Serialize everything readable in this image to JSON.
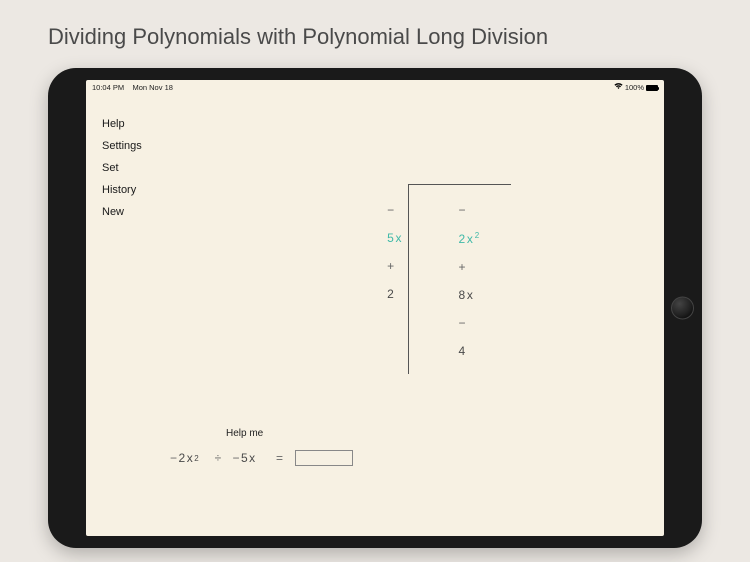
{
  "title": "Dividing Polynomials with Polynomial Long Division",
  "status": {
    "time": "10:04 PM",
    "date": "Mon Nov 18",
    "battery": "100%",
    "wifi": "wifi"
  },
  "menu": {
    "help": "Help",
    "settings": "Settings",
    "set": "Set",
    "history": "History",
    "new": "New"
  },
  "division": {
    "divisor_minus": "−",
    "divisor_5x": "5x",
    "divisor_plus": "+",
    "divisor_2": "2",
    "dividend_minus": "−",
    "dividend_2x": "2x",
    "dividend_exp": "2",
    "dividend_plus": "+",
    "dividend_8x": "8x",
    "dividend_minus2": "−",
    "dividend_4": "4"
  },
  "helpme": "Help me",
  "prompt": {
    "minus": "−",
    "left_2x": "2x",
    "exp": "2",
    "div": "÷",
    "minus2": "−",
    "right_5x": "5x",
    "eq": "="
  },
  "answer_value": ""
}
